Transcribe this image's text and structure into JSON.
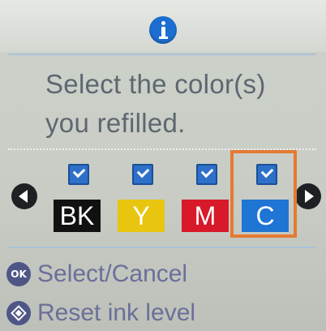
{
  "header": {
    "icon": "info-icon",
    "accent": "#1c6fd1"
  },
  "message": {
    "line1": "Select the color(s)",
    "line2": "you refilled."
  },
  "colors": [
    {
      "label": "BK",
      "checked": true,
      "color": "#111111"
    },
    {
      "label": "Y",
      "checked": true,
      "color": "#e8c50e"
    },
    {
      "label": "M",
      "checked": true,
      "color": "#d7192a"
    },
    {
      "label": "C",
      "checked": true,
      "color": "#1f75d4",
      "selected": true
    }
  ],
  "selection_color": "#e57a31",
  "hints": {
    "ok_icon_text": "OK",
    "ok_label": "Select/Cancel",
    "reset_label": "Reset ink level"
  }
}
